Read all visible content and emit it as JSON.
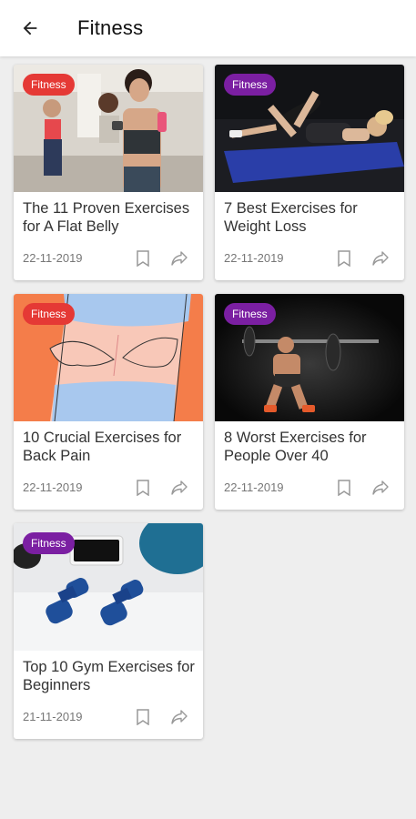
{
  "header": {
    "title": "Fitness",
    "back_icon": "arrow-left-icon"
  },
  "colors": {
    "badge_red": "#e53935",
    "badge_purple": "#7b1fa2",
    "background": "#eeeeee"
  },
  "articles": [
    {
      "category": "Fitness",
      "title": "The 11 Proven Exercises for A Flat Belly",
      "date": "22-11-2019"
    },
    {
      "category": "Fitness",
      "title": "7 Best Exercises for Weight Loss",
      "date": "22-11-2019"
    },
    {
      "category": "Fitness",
      "title": "10 Crucial Exercises for Back Pain",
      "date": "22-11-2019"
    },
    {
      "category": "Fitness",
      "title": "8 Worst Exercises for People Over 40",
      "date": "22-11-2019"
    },
    {
      "category": "Fitness",
      "title": "Top 10 Gym Exercises for Beginners",
      "date": "21-11-2019"
    }
  ]
}
